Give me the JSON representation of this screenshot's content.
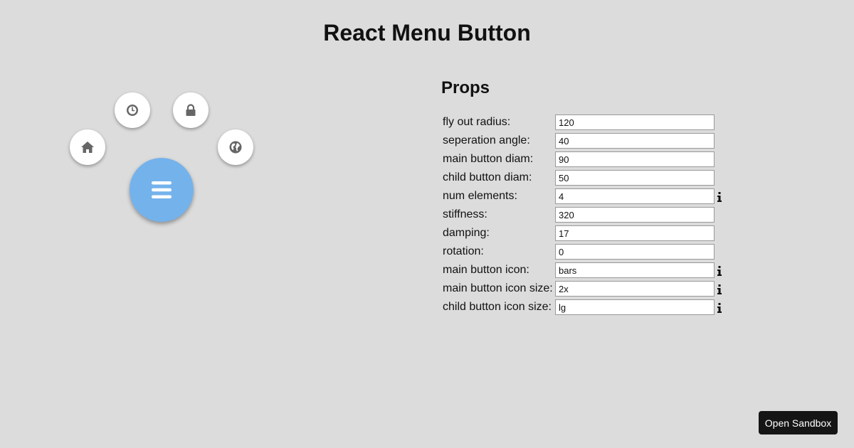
{
  "page": {
    "title": "React Menu Button"
  },
  "menu": {
    "main_icon": "bars-icon",
    "main_color": "#74b2ec",
    "child_icons": [
      "home-icon",
      "clock-icon",
      "lock-icon",
      "globe-icon"
    ]
  },
  "props": {
    "heading": "Props",
    "fields": [
      {
        "label": "fly out radius:",
        "value": "120",
        "info": false
      },
      {
        "label": "seperation angle:",
        "value": "40",
        "info": false
      },
      {
        "label": "main button diam:",
        "value": "90",
        "info": false
      },
      {
        "label": "child button diam:",
        "value": "50",
        "info": false
      },
      {
        "label": "num elements:",
        "value": "4",
        "info": true
      },
      {
        "label": "stiffness:",
        "value": "320",
        "info": false
      },
      {
        "label": "damping:",
        "value": "17",
        "info": false
      },
      {
        "label": "rotation:",
        "value": "0",
        "info": false
      },
      {
        "label": "main button icon:",
        "value": "bars",
        "info": true
      },
      {
        "label": "main button icon size:",
        "value": "2x",
        "info": true
      },
      {
        "label": "child button icon size:",
        "value": "lg",
        "info": true
      }
    ]
  },
  "sandbox": {
    "label": "Open Sandbox"
  }
}
